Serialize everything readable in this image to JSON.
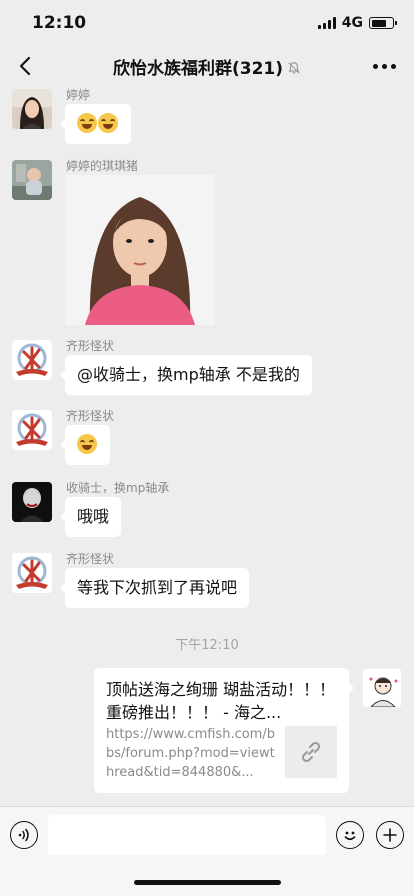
{
  "status_bar": {
    "time": "12:10",
    "network": "4G"
  },
  "header": {
    "title": "欣怡水族福利群(321)"
  },
  "messages": [
    {
      "sender": "婷婷",
      "type": "emoji",
      "emoji_count": 2
    },
    {
      "sender": "婷婷的琪琪猪",
      "type": "image"
    },
    {
      "sender": "齐形怪状",
      "type": "text",
      "text": "@收骑士，换mp轴承 不是我的"
    },
    {
      "sender": "齐形怪状",
      "type": "emoji",
      "emoji_count": 1
    },
    {
      "sender": "收骑士，换mp轴承",
      "type": "text",
      "text": "哦哦"
    },
    {
      "sender": "齐形怪状",
      "type": "text",
      "text": "等我下次抓到了再说吧"
    }
  ],
  "time_separator": "下午12:10",
  "link_card": {
    "title": "顶帖送海之绚珊 瑚盐活动！！！ 重磅推出！！！ - 海之...",
    "desc": "https://www.cmfish.com/bbs/forum.php?mod=viewthread&tid=844880&..."
  },
  "colors": {
    "background": "#ededed",
    "bubble": "#ffffff",
    "meta_text": "#8a8a8a"
  }
}
